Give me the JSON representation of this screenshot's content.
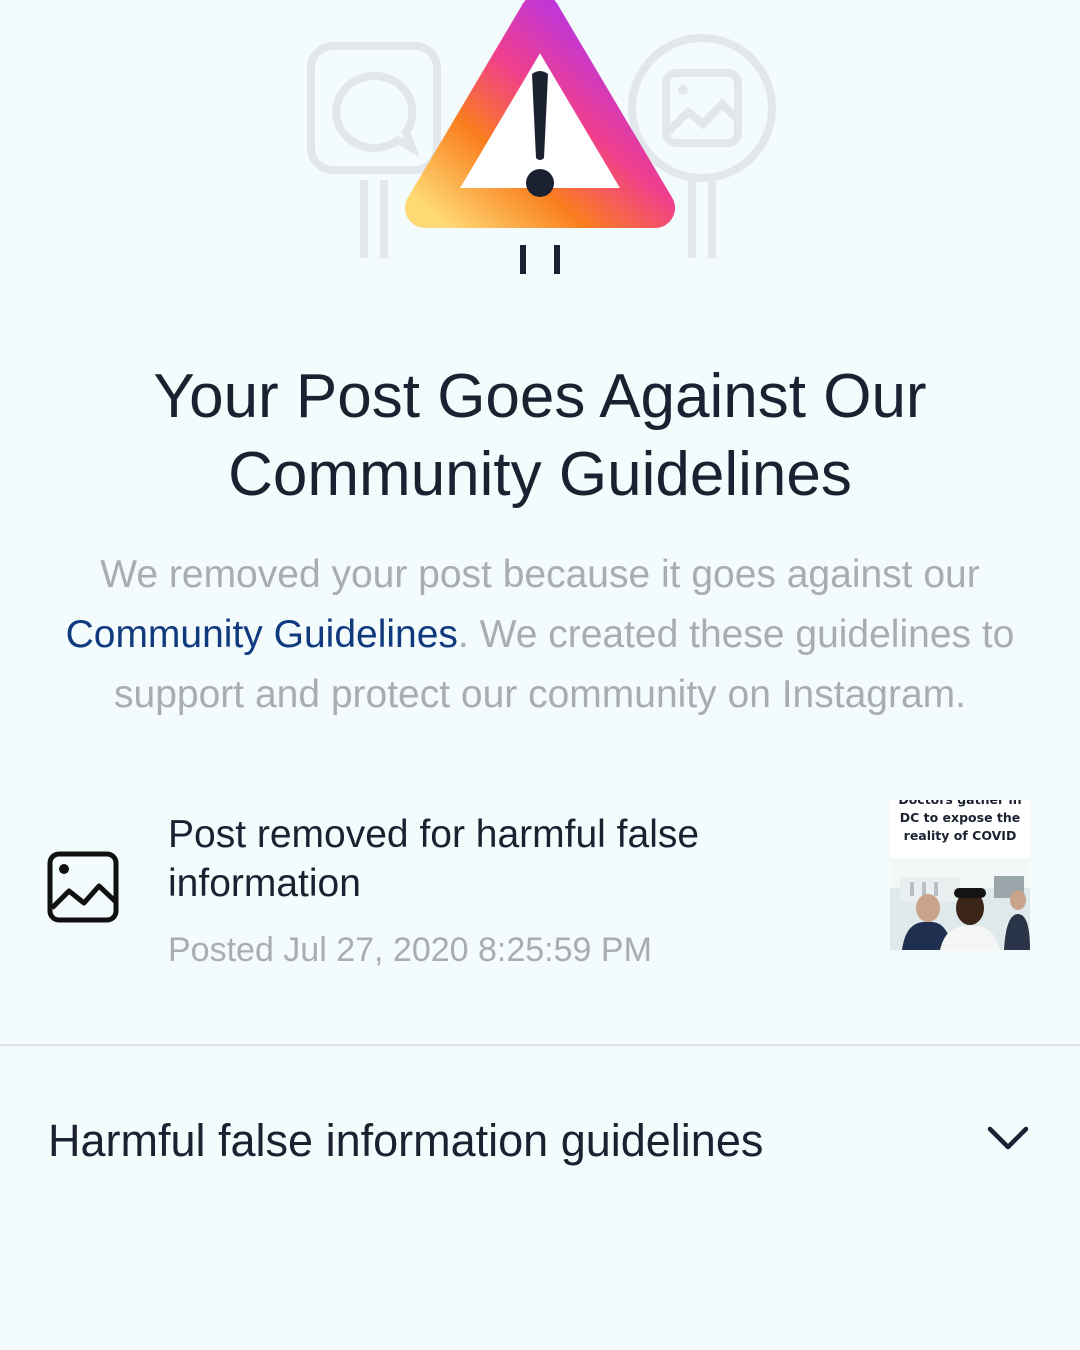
{
  "header": {
    "title_line1": "Your Post Goes Against Our",
    "title_line2": "Community Guidelines"
  },
  "description": {
    "before_link": "We removed your post because it goes against our",
    "link_text": "Community Guidelines",
    "after_link": ". We created these guidelines to support and protect our community on Instagram."
  },
  "post": {
    "title": "Post removed for harmful false information",
    "date": "Posted Jul 27, 2020 8:25:59 PM",
    "thumbnail_caption": "Doctors gather in\nDC to expose the\nreality of COVID",
    "icon": "image-icon"
  },
  "accordion": {
    "label": "Harmful false information guidelines",
    "icon": "chevron-down-icon"
  },
  "colors": {
    "background": "#f3fbfc",
    "link": "#103a7e",
    "muted_text": "#a9adb3",
    "primary_text": "#1b2130",
    "gradient": [
      "#feda75",
      "#fa7e1e",
      "#d62976",
      "#962fbf",
      "#4f5bd5"
    ]
  }
}
